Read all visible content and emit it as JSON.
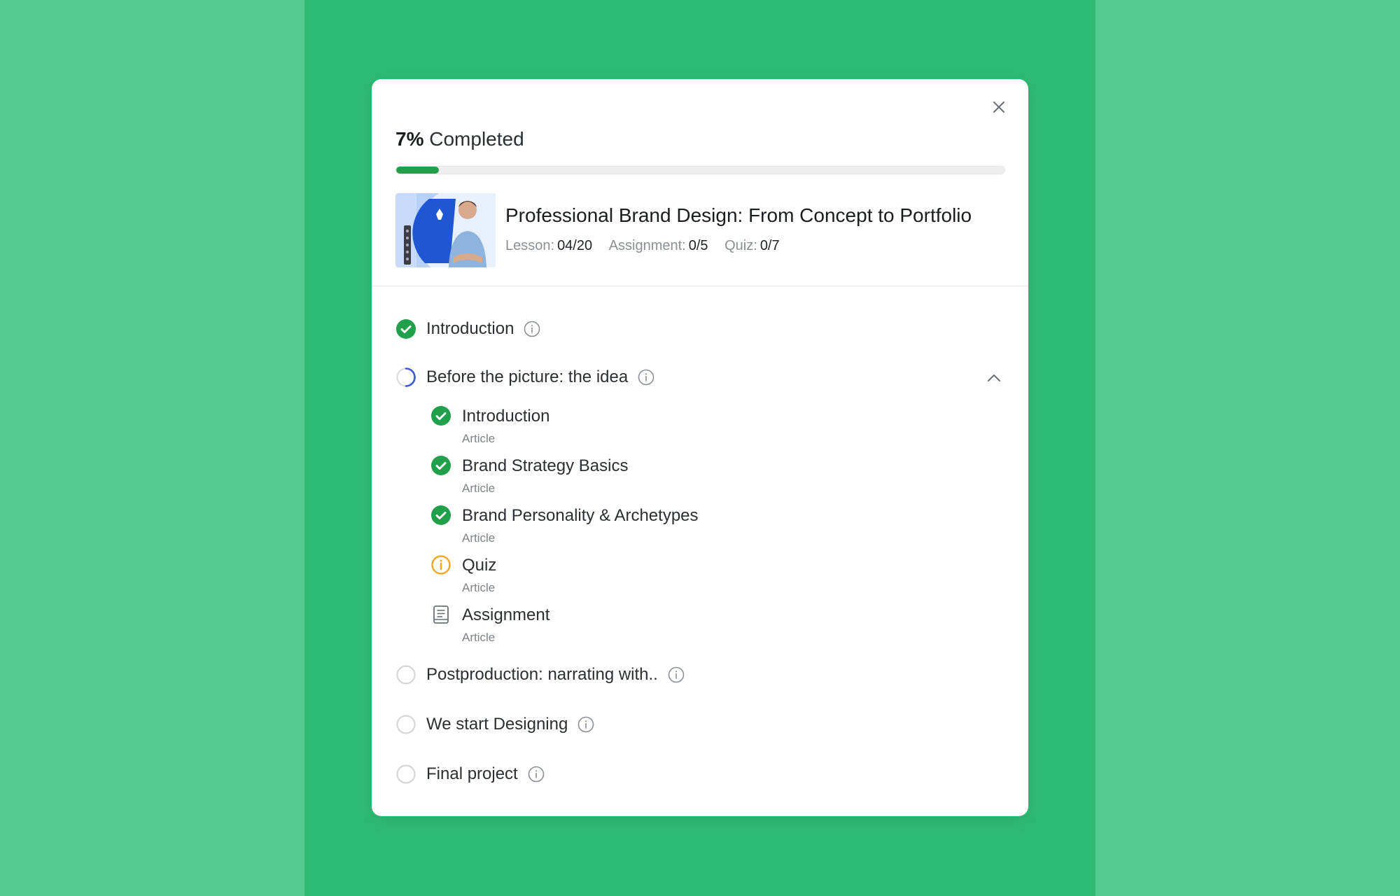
{
  "progress": {
    "percent_text": "7%",
    "completed_label": "Completed",
    "fraction": 0.07,
    "fill_color": "#20a04a"
  },
  "course": {
    "title": "Professional Brand Design: From Concept to Portfolio",
    "lesson_label": "Lesson:",
    "lesson_value": "04/20",
    "assignment_label": "Assignment:",
    "assignment_value": "0/5",
    "quiz_label": "Quiz:",
    "quiz_value": "0/7"
  },
  "topics": [
    {
      "label": "Introduction",
      "status": "completed"
    },
    {
      "label": "Before the picture: the idea",
      "status": "in-progress",
      "expanded": true,
      "lessons": [
        {
          "label": "Introduction",
          "type": "Article",
          "status": "completed"
        },
        {
          "label": "Brand Strategy Basics",
          "type": "Article",
          "status": "completed"
        },
        {
          "label": "Brand Personality & Archetypes",
          "type": "Article",
          "status": "completed"
        },
        {
          "label": "Quiz",
          "type": "Article",
          "status": "warning"
        },
        {
          "label": "Assignment",
          "type": "Article",
          "status": "document"
        }
      ]
    },
    {
      "label": "Postproduction: narrating with..",
      "status": "not-started"
    },
    {
      "label": "We start Designing",
      "status": "not-started"
    },
    {
      "label": "Final project",
      "status": "not-started"
    }
  ],
  "colors": {
    "outer_bg": "#57ca8f",
    "band_bg": "#2fba74",
    "success": "#20a04a",
    "warning": "#f5a623",
    "in_progress": "#3b5bdb"
  }
}
